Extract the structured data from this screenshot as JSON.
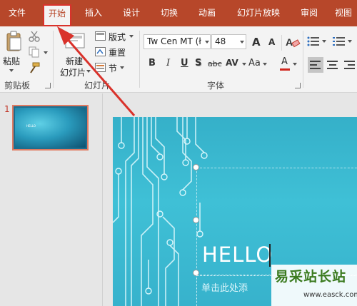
{
  "tabs": [
    {
      "id": "file",
      "label": "文件"
    },
    {
      "id": "home",
      "label": "开始"
    },
    {
      "id": "insert",
      "label": "插入"
    },
    {
      "id": "design",
      "label": "设计"
    },
    {
      "id": "transitions",
      "label": "切换"
    },
    {
      "id": "animations",
      "label": "动画"
    },
    {
      "id": "slideshow",
      "label": "幻灯片放映"
    },
    {
      "id": "review",
      "label": "审阅"
    },
    {
      "id": "view",
      "label": "视图"
    }
  ],
  "active_tab": "开始",
  "ribbon": {
    "clipboard": {
      "paste_label": "粘贴",
      "group_label": "剪贴板"
    },
    "slides": {
      "new_slide_line1": "新建",
      "new_slide_line2": "幻灯片",
      "layout_label": "版式",
      "reset_label": "重置",
      "section_label": "节",
      "group_label": "幻灯片"
    },
    "font": {
      "font_name": "Tw Cen MT (ł",
      "font_size": "48",
      "bold": "B",
      "italic": "I",
      "underline": "U",
      "shadow": "S",
      "strikethrough": "abc",
      "spacing": "AV",
      "case": "Aa",
      "color_a": "A",
      "grow": "A",
      "shrink": "A",
      "group_label": "字体"
    }
  },
  "thumbnails": [
    {
      "number": "1",
      "text": "HELLO"
    }
  ],
  "slide": {
    "title": "HELLO",
    "subtitle": "单击此处添"
  },
  "watermark": {
    "text": "易采站长站",
    "url": "www.easck.com"
  },
  "colors": {
    "accent": "#b7472a",
    "highlight": "#d9322b",
    "slide_bg": "#3fc0d6",
    "circuit": "#d8f6fb"
  }
}
